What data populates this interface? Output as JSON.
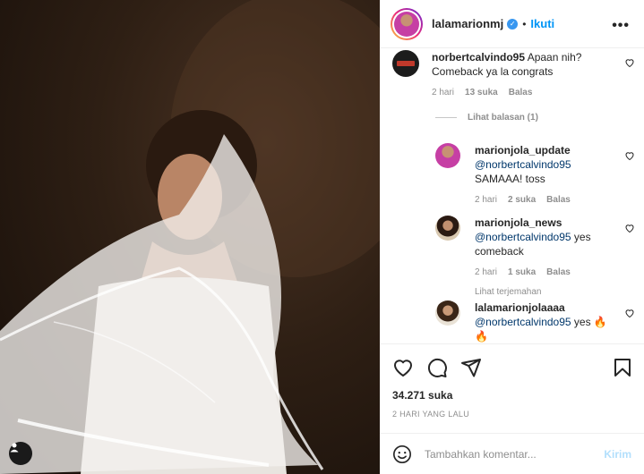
{
  "header": {
    "username": "lalamarionmj",
    "verified_icon": "verified-badge-icon",
    "separator": "•",
    "follow_label": "Ikuti",
    "more_label": "•••"
  },
  "comments": [
    {
      "username": "norbertcalvindo95",
      "text_line1": "Apaan nih?",
      "text_line2": "Comeback ya la congrats",
      "time": "2 hari",
      "likes": "13 suka",
      "reply": "Balas",
      "view_replies": "Lihat balasan (1)"
    },
    {
      "username": "marionjola_update",
      "mention": "@norbertcalvindo95",
      "text": "SAMAAA! toss",
      "time": "2 hari",
      "likes": "2 suka",
      "reply": "Balas"
    },
    {
      "username": "marionjola_news",
      "mention": "@norbertcalvindo95",
      "text": "yes",
      "text_line2": "comeback",
      "time": "2 hari",
      "likes": "1 suka",
      "reply": "Balas",
      "see_translation": "Lihat terjemahan"
    },
    {
      "username": "lalamarionjolaaaa",
      "mention": "@norbertcalvindo95",
      "text": "yes 🔥",
      "text_line2": "🔥"
    }
  ],
  "actions": {
    "likes_count": "34.271 suka",
    "posted_time": "2 HARI YANG LALU"
  },
  "add_comment": {
    "placeholder": "Tambahkan komentar...",
    "post_label": "Kirim"
  },
  "colors": {
    "link_blue": "#0095f6",
    "post_disabled": "#b2dffc",
    "meta_gray": "#8e8e8e",
    "mention_blue": "#00376b"
  }
}
